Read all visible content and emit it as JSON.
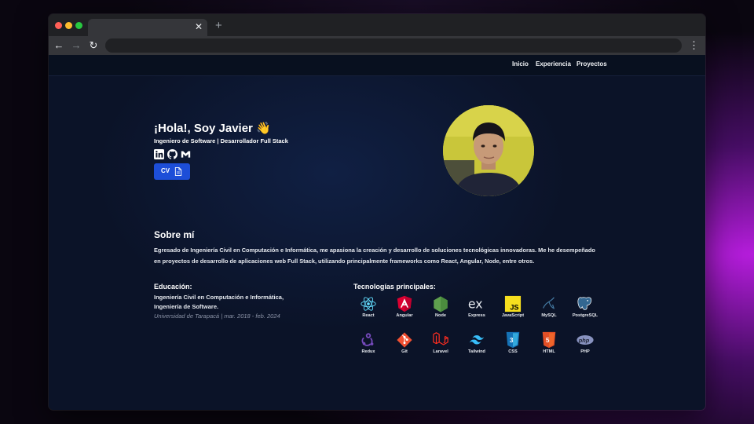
{
  "site_nav": {
    "links": [
      "Inicio",
      "Experiencia",
      "Proyectos"
    ]
  },
  "hero": {
    "greeting": "¡Hola!, Soy Javier 👋",
    "subtitle": "Ingeniero de Software | Desarrollador Full Stack",
    "social_icons": [
      "linkedin-icon",
      "github-icon",
      "gmail-icon"
    ],
    "cv_label": "CV",
    "cv_icon": "document-icon"
  },
  "about": {
    "title": "Sobre mí",
    "text": "Egresado de Ingeniería Civil en Computación e Informática, me apasiona la creación y desarrollo de soluciones tecnológicas innovadoras. Me he desempeñado en proyectos de desarrollo de aplicaciones web Full Stack, utilizando principalmente frameworks como React, Angular, Node, entre otros."
  },
  "education": {
    "heading": "Educación:",
    "degree": "Ingeniería Civil en Computación e Informática, Ingeniería de Software.",
    "meta": "Universidad de Tarapacá | mar. 2018 - feb. 2024"
  },
  "technologies": {
    "heading": "Tecnologías principales:",
    "items": [
      {
        "label": "React",
        "icon": "react-icon"
      },
      {
        "label": "Angular",
        "icon": "angular-icon"
      },
      {
        "label": "Node",
        "icon": "node-icon"
      },
      {
        "label": "Express",
        "icon": "express-icon"
      },
      {
        "label": "JavaScript",
        "icon": "javascript-icon"
      },
      {
        "label": "MySQL",
        "icon": "mysql-icon"
      },
      {
        "label": "PostgreSQL",
        "icon": "postgresql-icon"
      },
      {
        "label": "Redux",
        "icon": "redux-icon"
      },
      {
        "label": "Git",
        "icon": "git-icon"
      },
      {
        "label": "Laravel",
        "icon": "laravel-icon"
      },
      {
        "label": "Tailwind",
        "icon": "tailwind-icon"
      },
      {
        "label": "CSS",
        "icon": "css-icon"
      },
      {
        "label": "HTML",
        "icon": "html-icon"
      },
      {
        "label": "PHP",
        "icon": "php-icon"
      }
    ]
  },
  "colors": {
    "accent": "#1d4ed8",
    "page_background": "#0b1328",
    "nav_background": "#08101f"
  }
}
